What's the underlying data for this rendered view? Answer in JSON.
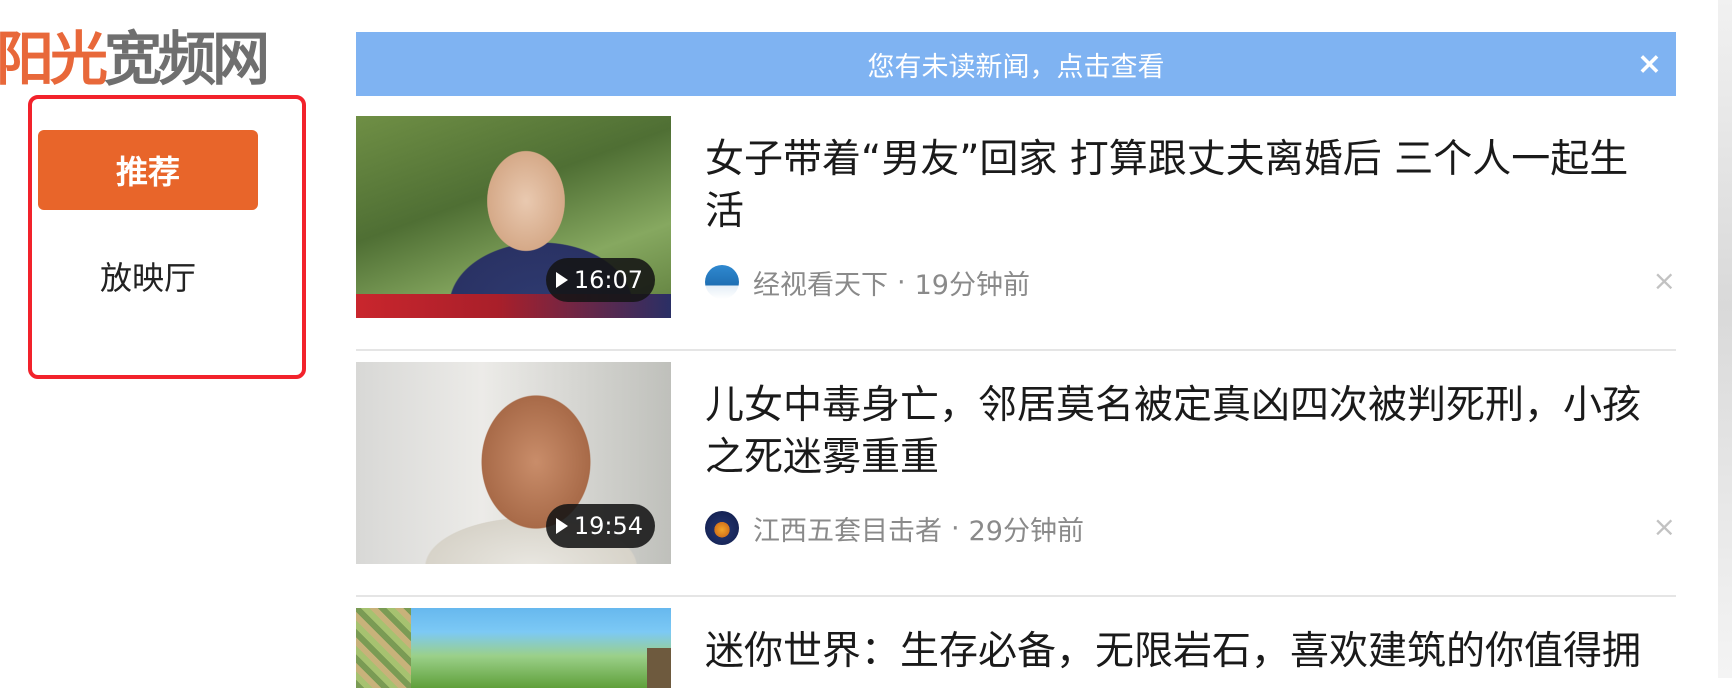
{
  "brand": {
    "logo_part_1": "阳光",
    "logo_part_2": "宽频网"
  },
  "sidebar": {
    "items": [
      {
        "label": "推荐",
        "active": true
      },
      {
        "label": "放映厅",
        "active": false
      }
    ],
    "highlight_color": "#f2222b",
    "active_color": "#e8652a"
  },
  "notice": {
    "text": "您有未读新闻，点击查看",
    "close_icon": "close-icon",
    "background": "#7fb3f2"
  },
  "feed": [
    {
      "title": "女子带着“男友”回家 打算跟丈夫离婚后 三个人一起生活",
      "duration": "16:07",
      "source": "经视看天下",
      "separator": "·",
      "time": "19分钟前",
      "dismiss_icon": "close-icon"
    },
    {
      "title": "儿女中毒身亡，邻居莫名被定真凶四次被判死刑，小孩之死迷雾重重",
      "duration": "19:54",
      "source": "江西五套目击者",
      "separator": "·",
      "time": "29分钟前",
      "dismiss_icon": "close-icon"
    },
    {
      "title": "迷你世界：生存必备，无限岩石，喜欢建筑的你值得拥"
    }
  ]
}
